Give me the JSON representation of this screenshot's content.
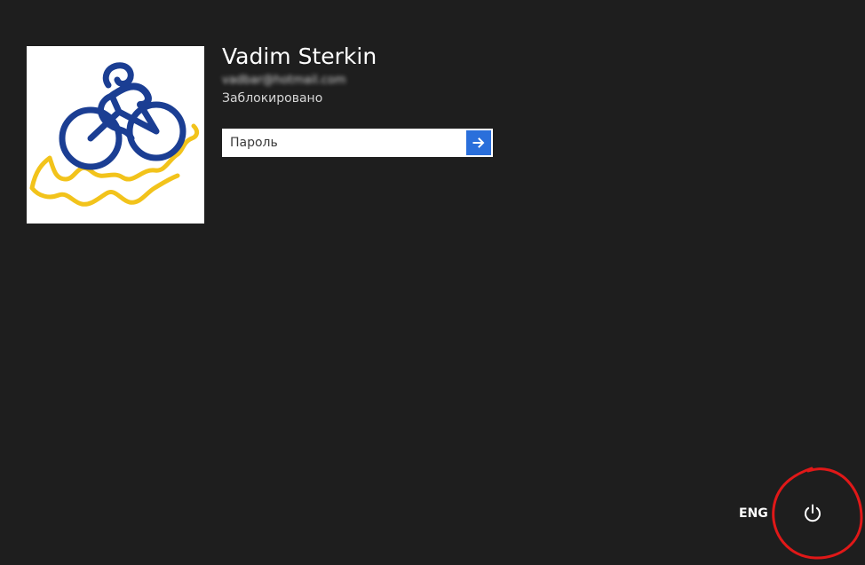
{
  "user": {
    "name": "Vadim Sterkin",
    "email": "vadbar@hotmail.com",
    "status": "Заблокировано",
    "avatar_icon": "cyclist-logo-icon"
  },
  "password": {
    "placeholder": "Пароль",
    "value": "",
    "submit_icon": "arrow-right-icon"
  },
  "footer": {
    "language": "ENG",
    "power_icon": "power-icon"
  },
  "colors": {
    "background": "#1e1e1e",
    "accent": "#2a6fdb",
    "logo_blue": "#1b3e93",
    "logo_yellow": "#f2c31b",
    "annotation_red": "#e01818"
  }
}
